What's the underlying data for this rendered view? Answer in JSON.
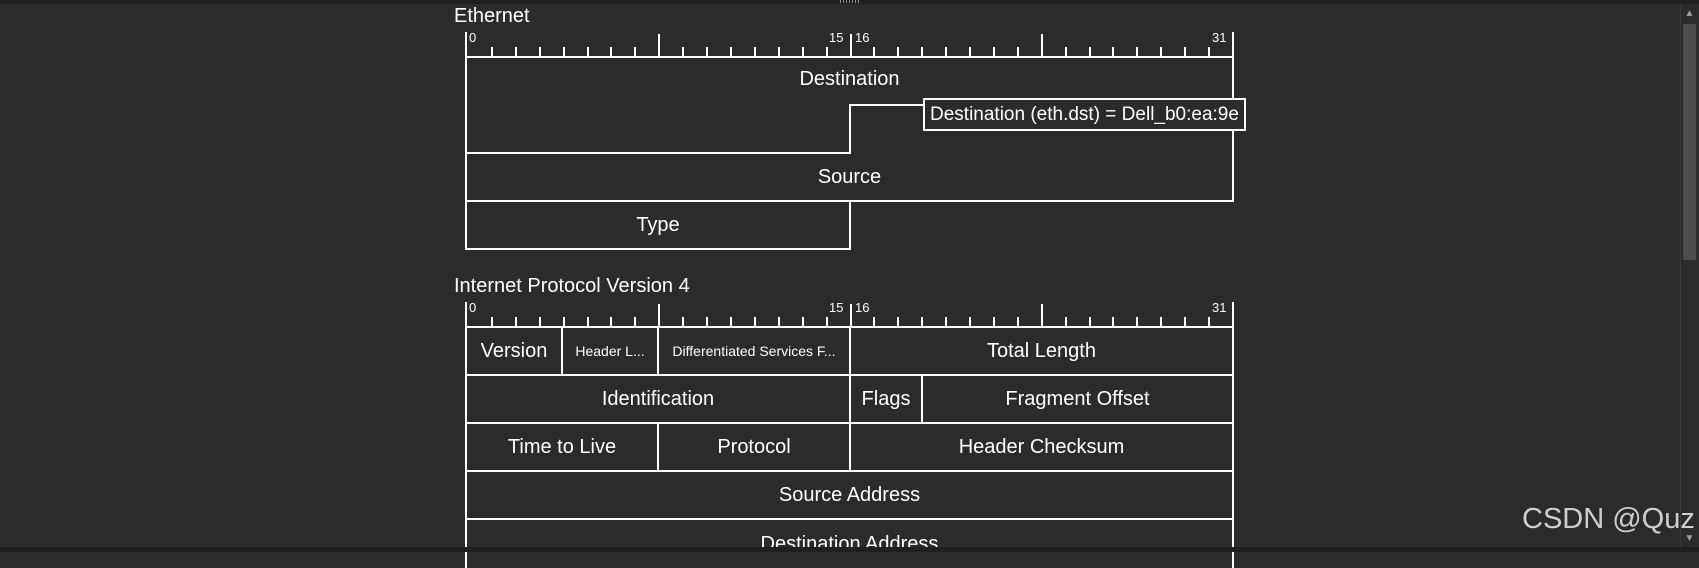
{
  "ethernet": {
    "title": "Ethernet",
    "ruler": {
      "start": "0",
      "mid_left": "15",
      "mid_right": "16",
      "end": "31"
    },
    "fields": {
      "destination": "Destination",
      "source": "Source",
      "type": "Type"
    },
    "tooltip": "Destination (eth.dst) = Dell_b0:ea:9e"
  },
  "ipv4": {
    "title": "Internet Protocol Version 4",
    "ruler": {
      "start": "0",
      "mid_left": "15",
      "mid_right": "16",
      "end": "31"
    },
    "fields": {
      "version": "Version",
      "header_length": "Header L...",
      "dsf": "Differentiated Services F...",
      "total_length": "Total Length",
      "identification": "Identification",
      "flags": "Flags",
      "fragment_offset": "Fragment Offset",
      "ttl": "Time to Live",
      "protocol": "Protocol",
      "header_checksum": "Header Checksum",
      "source_address": "Source Address",
      "destination_address": "Destination Address"
    }
  },
  "watermark": "CSDN @Quz",
  "colors": {
    "background": "#2b2b2b",
    "lines": "#ffffff",
    "text": "#ffffff"
  },
  "icons": {
    "scroll_up": "scroll-up-icon",
    "scroll_down": "scroll-down-icon"
  }
}
